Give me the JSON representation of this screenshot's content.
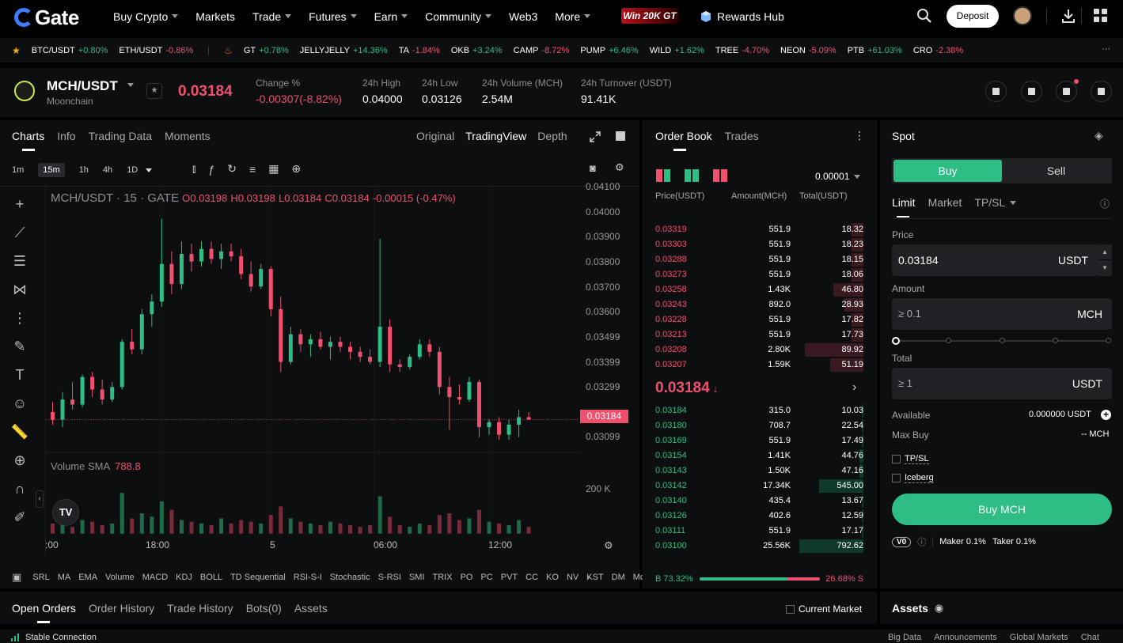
{
  "nav": {
    "logo": "Gate",
    "menu": [
      {
        "label": "Buy Crypto",
        "dropdown": true
      },
      {
        "label": "Markets",
        "dropdown": false
      },
      {
        "label": "Trade",
        "dropdown": true
      },
      {
        "label": "Futures",
        "dropdown": true
      },
      {
        "label": "Earn",
        "dropdown": true
      },
      {
        "label": "Community",
        "dropdown": true
      },
      {
        "label": "Web3",
        "dropdown": false
      },
      {
        "label": "More",
        "dropdown": true
      }
    ],
    "promo": "Win 20K GT",
    "rewards": "Rewards Hub",
    "deposit": "Deposit"
  },
  "ticker": [
    {
      "pair": "BTC/USDT",
      "change": "+0.80%",
      "up": true
    },
    {
      "pair": "ETH/USDT",
      "change": "-0.86%",
      "up": false
    },
    {
      "pair": "GT",
      "change": "+0.78%",
      "up": true
    },
    {
      "pair": "JELLYJELLY",
      "change": "+14.36%",
      "up": true
    },
    {
      "pair": "TA",
      "change": "-1.84%",
      "up": false
    },
    {
      "pair": "OKB",
      "change": "+3.24%",
      "up": true
    },
    {
      "pair": "CAMP",
      "change": "-8.72%",
      "up": false
    },
    {
      "pair": "PUMP",
      "change": "+6.46%",
      "up": true
    },
    {
      "pair": "WILD",
      "change": "+1.62%",
      "up": true
    },
    {
      "pair": "TREE",
      "change": "-4.70%",
      "up": false
    },
    {
      "pair": "NEON",
      "change": "-5.09%",
      "up": false
    },
    {
      "pair": "PTB",
      "change": "+61.03%",
      "up": true
    },
    {
      "pair": "CRO",
      "change": "-2.38%",
      "up": false
    }
  ],
  "market": {
    "pair": "MCH/USDT",
    "name": "Moonchain",
    "last": "0.03184",
    "stats": [
      {
        "label": "Change %",
        "value": "-0.00307(-8.82%)",
        "red": true
      },
      {
        "label": "24h High",
        "value": "0.04000",
        "red": false
      },
      {
        "label": "24h Low",
        "value": "0.03126",
        "red": false
      },
      {
        "label": "24h Volume (MCH)",
        "value": "2.54M",
        "red": false
      },
      {
        "label": "24h Turnover (USDT)",
        "value": "91.41K",
        "red": false
      }
    ]
  },
  "chart": {
    "tabs": [
      "Charts",
      "Info",
      "Trading Data",
      "Moments"
    ],
    "views": [
      "Original",
      "TradingView",
      "Depth"
    ],
    "timeframes": [
      "1m",
      "15m",
      "1h",
      "4h",
      "1D"
    ],
    "ohlc": {
      "title": "MCH/USDT · 15 · GATE",
      "o": "O0.03198",
      "h": "H0.03198",
      "l": "L0.03184",
      "c": "C0.03184",
      "chg": "-0.00015 (-0.47%)"
    },
    "volume_label": "Volume SMA",
    "volume_value": "788.8",
    "price_tag": "0.03184",
    "y_labels": [
      "0.04100",
      "0.04000",
      "0.03900",
      "0.03800",
      "0.03700",
      "0.03600",
      "0.03499",
      "0.03399",
      "0.03299",
      "0.03099"
    ],
    "vol_axis": "200 K",
    "x_labels": [
      ":00",
      "18:00",
      "5",
      "06:00",
      "12:00"
    ],
    "indicators": [
      "SRL",
      "MA",
      "EMA",
      "Volume",
      "MACD",
      "KDJ",
      "BOLL",
      "TD Sequential",
      "RSI-S-I",
      "Stochastic",
      "S-RSI",
      "SMI",
      "TRIX",
      "PO",
      "PC",
      "PVT",
      "CC",
      "KO",
      "NV",
      "KST",
      "DM",
      "Mor"
    ]
  },
  "orderbook": {
    "tabs": [
      "Order Book",
      "Trades"
    ],
    "precision": "0.00001",
    "headers": [
      "Price(USDT)",
      "Amount(MCH)",
      "Total(USDT)"
    ],
    "asks": [
      {
        "p": "0.03319",
        "a": "551.9",
        "t": "18.32"
      },
      {
        "p": "0.03303",
        "a": "551.9",
        "t": "18.23"
      },
      {
        "p": "0.03288",
        "a": "551.9",
        "t": "18.15"
      },
      {
        "p": "0.03273",
        "a": "551.9",
        "t": "18.06"
      },
      {
        "p": "0.03258",
        "a": "1.43K",
        "t": "46.80"
      },
      {
        "p": "0.03243",
        "a": "892.0",
        "t": "28.93"
      },
      {
        "p": "0.03228",
        "a": "551.9",
        "t": "17.82"
      },
      {
        "p": "0.03213",
        "a": "551.9",
        "t": "17.73"
      },
      {
        "p": "0.03208",
        "a": "2.80K",
        "t": "89.92"
      },
      {
        "p": "0.03207",
        "a": "1.59K",
        "t": "51.19"
      }
    ],
    "mid": "0.03184",
    "bids": [
      {
        "p": "0.03184",
        "a": "315.0",
        "t": "10.03"
      },
      {
        "p": "0.03180",
        "a": "708.7",
        "t": "22.54"
      },
      {
        "p": "0.03169",
        "a": "551.9",
        "t": "17.49"
      },
      {
        "p": "0.03154",
        "a": "1.41K",
        "t": "44.76"
      },
      {
        "p": "0.03143",
        "a": "1.50K",
        "t": "47.16"
      },
      {
        "p": "0.03142",
        "a": "17.34K",
        "t": "545.00"
      },
      {
        "p": "0.03140",
        "a": "435.4",
        "t": "13.67"
      },
      {
        "p": "0.03126",
        "a": "402.6",
        "t": "12.59"
      },
      {
        "p": "0.03111",
        "a": "551.9",
        "t": "17.17"
      },
      {
        "p": "0.03100",
        "a": "25.56K",
        "t": "792.62"
      }
    ],
    "buy_ratio": "B 73.32%",
    "sell_ratio": "26.68% S",
    "buy_ratio_value": 0.7332
  },
  "trade": {
    "title": "Spot",
    "buy": "Buy",
    "sell": "Sell",
    "order_types": [
      "Limit",
      "Market",
      "TP/SL"
    ],
    "price_label": "Price",
    "price_value": "0.03184",
    "price_unit": "USDT",
    "amount_label": "Amount",
    "amount_placeholder": "≥ 0.1",
    "amount_unit": "MCH",
    "total_label": "Total",
    "total_placeholder": "≥ 1",
    "total_unit": "USDT",
    "available_label": "Available",
    "available_value": "0.000000 USDT",
    "maxbuy_label": "Max Buy",
    "maxbuy_value": "-- MCH",
    "tpsl": "TP/SL",
    "iceberg": "Iceberg",
    "submit": "Buy MCH",
    "vip": "V0",
    "maker": "Maker 0.1%",
    "taker": "Taker 0.1%"
  },
  "bottom": {
    "tabs": [
      "Open Orders",
      "Order History",
      "Trade History",
      "Bots(0)",
      "Assets"
    ],
    "current_market": "Current Market",
    "assets_title": "Assets"
  },
  "status": {
    "connection": "Stable Connection",
    "links": [
      "Big Data",
      "Announcements",
      "Global Markets",
      "Chat"
    ]
  },
  "colors": {
    "up": "#2dbd85",
    "down": "#f0506e",
    "brand": "#3f7bff"
  },
  "chart_data": {
    "type": "candlestick",
    "timeframe": "15m",
    "ylim": [
      0.0305,
      0.0411
    ],
    "x_ticks": [
      ":00",
      "18:00",
      "5",
      "06:00",
      "12:00"
    ],
    "candles": [
      [
        0.0321,
        0.0325,
        0.0316,
        0.0318
      ],
      [
        0.0318,
        0.0329,
        0.0315,
        0.0326
      ],
      [
        0.0326,
        0.0333,
        0.0322,
        0.0324
      ],
      [
        0.0324,
        0.0336,
        0.0323,
        0.0335
      ],
      [
        0.0335,
        0.0337,
        0.0327,
        0.033
      ],
      [
        0.033,
        0.0334,
        0.0324,
        0.0326
      ],
      [
        0.0326,
        0.0333,
        0.0325,
        0.0331
      ],
      [
        0.0331,
        0.035,
        0.033,
        0.0349
      ],
      [
        0.0349,
        0.0354,
        0.0344,
        0.0346
      ],
      [
        0.0346,
        0.0362,
        0.0344,
        0.036
      ],
      [
        0.036,
        0.0368,
        0.0355,
        0.0365
      ],
      [
        0.0365,
        0.0398,
        0.0363,
        0.038
      ],
      [
        0.038,
        0.0385,
        0.0368,
        0.0372
      ],
      [
        0.0372,
        0.0389,
        0.037,
        0.0384
      ],
      [
        0.0384,
        0.0388,
        0.0377,
        0.0381
      ],
      [
        0.0381,
        0.0389,
        0.0379,
        0.0386
      ],
      [
        0.0386,
        0.0389,
        0.038,
        0.0382
      ],
      [
        0.0382,
        0.0388,
        0.0378,
        0.0385
      ],
      [
        0.0385,
        0.0388,
        0.0381,
        0.0383
      ],
      [
        0.0383,
        0.0386,
        0.0374,
        0.0376
      ],
      [
        0.0376,
        0.0381,
        0.0369,
        0.0371
      ],
      [
        0.0371,
        0.038,
        0.037,
        0.0378
      ],
      [
        0.0378,
        0.0379,
        0.0359,
        0.0362
      ],
      [
        0.0362,
        0.0367,
        0.0337,
        0.0341
      ],
      [
        0.0341,
        0.0355,
        0.034,
        0.0352
      ],
      [
        0.0352,
        0.0354,
        0.0345,
        0.0348
      ],
      [
        0.0348,
        0.0352,
        0.0343,
        0.035
      ],
      [
        0.035,
        0.0353,
        0.0346,
        0.0347
      ],
      [
        0.0347,
        0.0351,
        0.0342,
        0.0349
      ],
      [
        0.0349,
        0.0351,
        0.0345,
        0.0347
      ],
      [
        0.0347,
        0.0349,
        0.0342,
        0.0345
      ],
      [
        0.0345,
        0.0347,
        0.0341,
        0.0343
      ],
      [
        0.0343,
        0.0346,
        0.034,
        0.0341
      ],
      [
        0.0341,
        0.039,
        0.0339,
        0.0355
      ],
      [
        0.0355,
        0.0358,
        0.0337,
        0.034
      ],
      [
        0.034,
        0.0342,
        0.0337,
        0.0339
      ],
      [
        0.0339,
        0.0344,
        0.0338,
        0.0343
      ],
      [
        0.0343,
        0.035,
        0.0342,
        0.0348
      ],
      [
        0.0348,
        0.035,
        0.0343,
        0.0345
      ],
      [
        0.0345,
        0.0347,
        0.0328,
        0.0331
      ],
      [
        0.0331,
        0.0335,
        0.0314,
        0.0327
      ],
      [
        0.0327,
        0.0332,
        0.0324,
        0.0326
      ],
      [
        0.0326,
        0.0335,
        0.0325,
        0.0333
      ],
      [
        0.0333,
        0.0334,
        0.0311,
        0.0315
      ],
      [
        0.0315,
        0.0318,
        0.0312,
        0.0317
      ],
      [
        0.0317,
        0.0319,
        0.031,
        0.0312
      ],
      [
        0.0312,
        0.0318,
        0.031,
        0.0316
      ],
      [
        0.0316,
        0.0322,
        0.0311,
        0.0319
      ],
      [
        0.0319,
        0.0321,
        0.0318,
        0.0318
      ]
    ],
    "volumes": [
      30,
      55,
      20,
      40,
      35,
      25,
      30,
      120,
      45,
      60,
      50,
      95,
      70,
      40,
      35,
      30,
      25,
      45,
      30,
      40,
      35,
      30,
      55,
      80,
      45,
      35,
      30,
      25,
      35,
      30,
      25,
      20,
      25,
      110,
      50,
      25,
      20,
      30,
      25,
      55,
      60,
      40,
      45,
      70,
      35,
      30,
      25,
      40,
      20
    ]
  }
}
